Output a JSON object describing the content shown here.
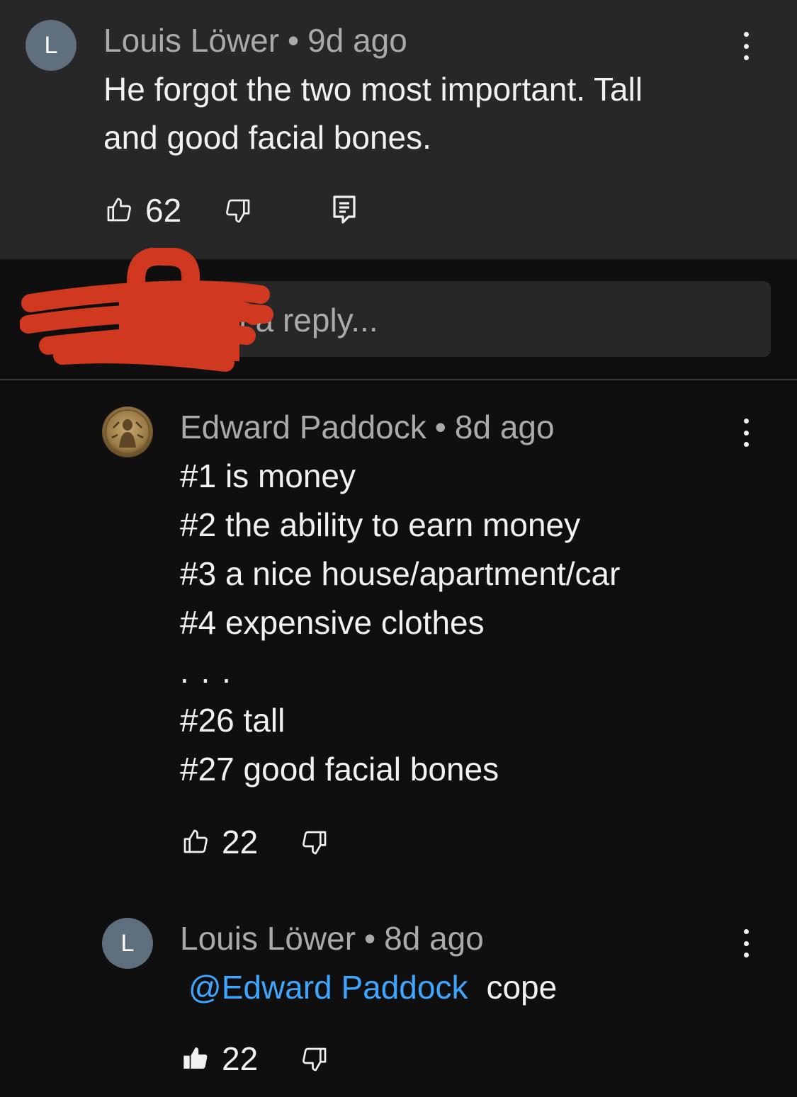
{
  "comment": {
    "avatar_letter": "L",
    "author": "Louis Löwer",
    "separator": "•",
    "time": "9d ago",
    "text_line1": "He forgot the two most important. Tall",
    "text_line2": "and good facial bones.",
    "likes": "62"
  },
  "reply_input": {
    "placeholder": "Add a reply..."
  },
  "reply1": {
    "author": "Edward Paddock",
    "separator": "•",
    "time": "8d ago",
    "lines": [
      "#1 is money",
      "#2 the ability to earn money",
      "#3 a nice house/apartment/car",
      "#4 expensive clothes",
      ". . .",
      "#26 tall",
      "#27 good facial bones"
    ],
    "likes": "22"
  },
  "reply2": {
    "avatar_letter": "L",
    "author": "Louis Löwer",
    "separator": "•",
    "time": "8d ago",
    "mention": "@Edward Paddock",
    "text": "cope",
    "likes": "22"
  },
  "colors": {
    "background": "#0f0f0f",
    "card": "#272727",
    "mention": "#3ea6ff",
    "redaction": "#d0391f"
  }
}
